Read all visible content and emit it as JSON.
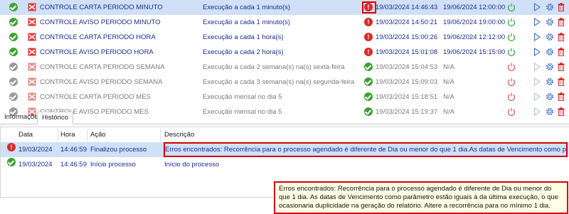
{
  "schedules": [
    {
      "status": "ok",
      "name": "CONTROLE CARTA PERIODO MINUTO",
      "recurrence": "Execução a cada 1 minuto(s)",
      "last_status": "error",
      "last": "19/03/2024 14:46:43",
      "next": "19/06/2024 12:00:00",
      "active": true,
      "selected": true
    },
    {
      "status": "ok",
      "name": "CONTROLE AVISO PERIODO MINUTO",
      "recurrence": "Execução a cada 1 minuto(s)",
      "last_status": "error",
      "last": "19/03/2024 14:50:21",
      "next": "19/06/2024 19:00:00",
      "active": true,
      "selected": false
    },
    {
      "status": "ok",
      "name": "CONTROLE CARTA PERIODO HORA",
      "recurrence": "Execução a cada 1 hora(s)",
      "last_status": "error",
      "last": "19/03/2024 15:00:26",
      "next": "19/06/2024 12:12:00",
      "active": true,
      "selected": false
    },
    {
      "status": "ok",
      "name": "CONTROLE AVISO PERIODO HORA",
      "recurrence": "Execução a cada 2 hora(s)",
      "last_status": "error",
      "last": "19/03/2024 15:01:08",
      "next": "19/06/2024 15:15:00",
      "active": true,
      "selected": false
    },
    {
      "status": "grey",
      "name": "CONTROLE CARTA PERIODO SEMANA",
      "recurrence": "Execução a cada 2 semana(s) na(s) sexta-feira",
      "last_status": "ok",
      "last": "19/03/2024 15:04:53",
      "next": "N/A",
      "active": false,
      "selected": false
    },
    {
      "status": "grey",
      "name": "CONTROLE AVISO PERIODO SEMANA",
      "recurrence": "Execução a cada 3 semana(s) na(s) segunda-feira",
      "last_status": "ok",
      "last": "19/03/2024 15:09:03",
      "next": "N/A",
      "active": false,
      "selected": false
    },
    {
      "status": "grey",
      "name": "CONTROLE CARTA PERIODO MES",
      "recurrence": "Execução mensal no dia 5",
      "last_status": "ok",
      "last": "19/03/2024 15:18:51",
      "next": "N/A",
      "active": false,
      "selected": false
    },
    {
      "status": "grey",
      "name": "CONTROLE AVISO PERIODO MES",
      "recurrence": "Execução mensal no dia 5",
      "last_status": "ok",
      "last": "19/03/2024 15:19:37",
      "next": "N/A",
      "active": false,
      "selected": false
    }
  ],
  "tabs": {
    "info": "Informações",
    "history": "Histórico"
  },
  "history": {
    "headers": {
      "date": "Data",
      "time": "Hora",
      "action": "Ação",
      "description": "Descrição"
    },
    "rows": [
      {
        "status": "error",
        "date": "19/03/2024",
        "time": "14:46:59",
        "action": "Finalizou processo",
        "description": "Erros encontrados: Recorrência para o processo agendado é diferente de Dia ou menor do que 1 dia.As datas de Vencimento como parâmetro estão iguais"
      },
      {
        "status": "ok",
        "date": "19/03/2024",
        "time": "14:46:59",
        "action": "Início processo",
        "description": "Início do processo"
      }
    ]
  },
  "tooltip": {
    "text": "Erros encontrados: Recorrência para o processo agendado é diferente de Dia ou menor do que 1 dia. As datas de Vencimento como parâmetro estão iguais à da última execução, o que ocasionaria duplicidade na geração do relatório. Altere a recorrência para no mínimo 1 dia."
  },
  "colors": {
    "active_text": "#1c2d8c",
    "inactive_text": "#7a7a7a",
    "selection": "#cfe0f7",
    "error": "#d62b2b",
    "ok": "#3aa32f",
    "highlight": "#d40000",
    "power_on": "#37b34a",
    "power_off": "#e06060",
    "tooltip_bg": "#ffffe6"
  },
  "icons": {
    "status_ok": "check-circle-icon",
    "status_error": "error-circle-icon",
    "type": "report-red-icon",
    "power": "power-icon",
    "run": "play-icon",
    "settings": "gear-icon",
    "delete": "trash-icon"
  }
}
